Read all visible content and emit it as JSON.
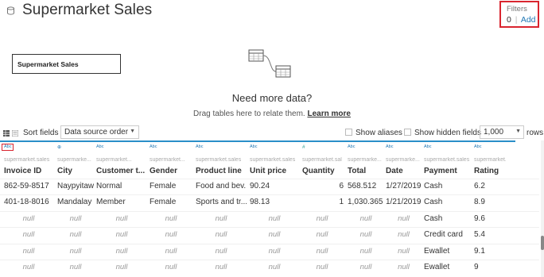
{
  "header": {
    "title": "Supermarket Sales"
  },
  "filters": {
    "label": "Filters",
    "count": "0",
    "separator": "|",
    "add_label": "Add"
  },
  "connection": {
    "table_name": "Supermarket Sales"
  },
  "relate": {
    "headline": "Need more data?",
    "hint": "Drag tables here to relate them.",
    "learn_more": "Learn more"
  },
  "toolbar": {
    "sort_label": "Sort fields",
    "sort_value": "Data source order",
    "show_aliases": "Show aliases",
    "show_hidden": "Show hidden fields",
    "rows_value": "1,000",
    "rows_label": "rows"
  },
  "columns": [
    {
      "type": "Abc",
      "source": "supermarket.sales",
      "name": "Invoice ID"
    },
    {
      "type": "geo",
      "source": "supermarke...",
      "name": "City"
    },
    {
      "type": "Abc",
      "source": "supermarket...",
      "name": "Customer t..."
    },
    {
      "type": "Abc",
      "source": "supermarket...",
      "name": "Gender"
    },
    {
      "type": "Abc",
      "source": "supermarket.sales",
      "name": "Product line"
    },
    {
      "type": "Abc",
      "source": "supermarket.sales",
      "name": "Unit price"
    },
    {
      "type": "#",
      "source": "supermarket.sales",
      "name": "Quantity"
    },
    {
      "type": "Abc",
      "source": "supermarke...",
      "name": "Total"
    },
    {
      "type": "Abc",
      "source": "supermarke...",
      "name": "Date"
    },
    {
      "type": "Abc",
      "source": "supermarket.sales",
      "name": "Payment"
    },
    {
      "type": "Abc",
      "source": "supermarket.sales",
      "name": "Rating"
    }
  ],
  "rows": [
    [
      "862-59-8517",
      "Naypyitaw",
      "Normal",
      "Female",
      "Food and bev...",
      "90.24",
      "6",
      "568.512",
      "1/27/2019",
      "Cash",
      "6.2"
    ],
    [
      "401-18-8016",
      "Mandalay",
      "Member",
      "Female",
      "Sports and tr...",
      "98.13",
      "1",
      "1,030.365",
      "1/21/2019",
      "Cash",
      "8.9"
    ],
    [
      "null",
      "null",
      "null",
      "null",
      "null",
      "null",
      "null",
      "null",
      "null",
      "Cash",
      "9.6"
    ],
    [
      "null",
      "null",
      "null",
      "null",
      "null",
      "null",
      "null",
      "null",
      "null",
      "Credit card",
      "5.4"
    ],
    [
      "null",
      "null",
      "null",
      "null",
      "null",
      "null",
      "null",
      "null",
      "null",
      "Ewallet",
      "9.1"
    ],
    [
      "null",
      "null",
      "null",
      "null",
      "null",
      "null",
      "null",
      "null",
      "null",
      "Ewallet",
      "9"
    ]
  ],
  "colors": {
    "accent": "#2a8fc8",
    "highlight": "#d9252f",
    "link": "#1f77b4"
  }
}
